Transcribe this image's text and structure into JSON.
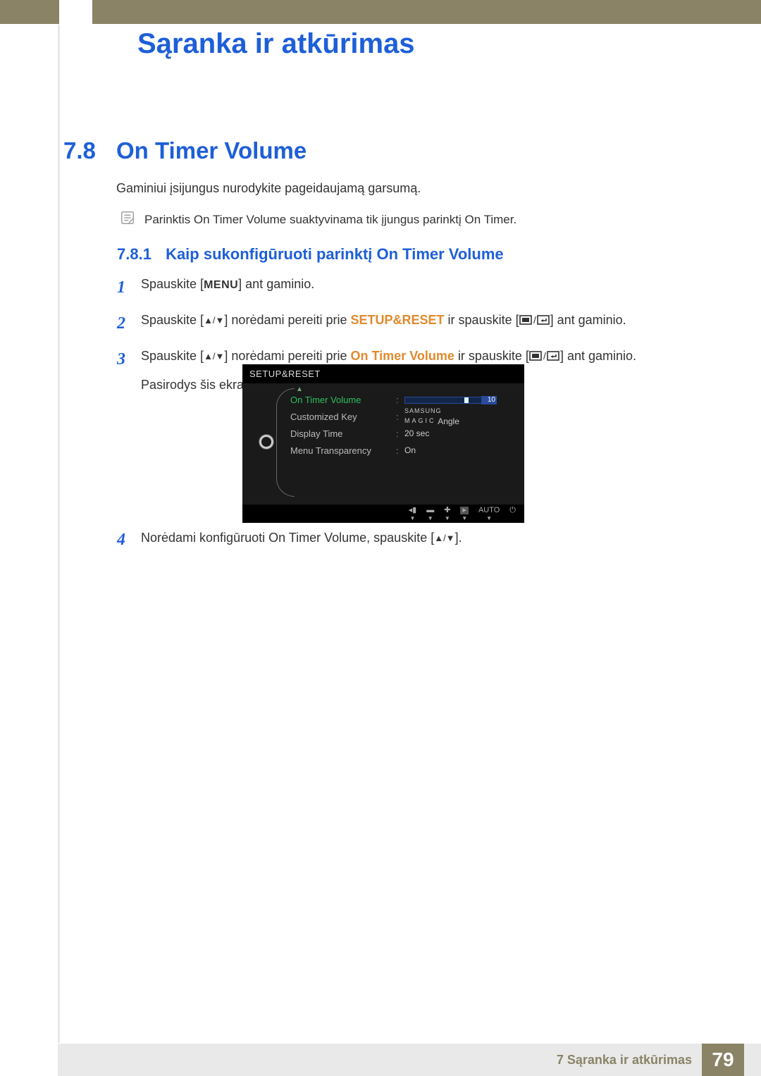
{
  "chapter_title": "Sąranka ir atkūrimas",
  "section": {
    "num": "7.8",
    "title": "On Timer Volume"
  },
  "intro": "Gaminiui įsijungus nurodykite pageidaujamą garsumą.",
  "note": {
    "pre": "Parinktis ",
    "kw1": "On Timer Volume",
    "mid": " suaktyvinama tik įjungus parinktį ",
    "kw2": "On Timer",
    "post": "."
  },
  "subsection": {
    "num": "7.8.1",
    "title": "Kaip sukonfigūruoti parinktį On Timer Volume"
  },
  "steps": {
    "s1": {
      "n": "1",
      "a": "Spauskite [",
      "menu": "MENU",
      "b": "] ant gaminio."
    },
    "s2": {
      "n": "2",
      "a": "Spauskite [",
      "b": "] norėdami pereiti prie ",
      "kw": "SETUP&RESET",
      "c": " ir spauskite [",
      "d": "] ant gaminio."
    },
    "s3": {
      "n": "3",
      "a": "Spauskite [",
      "b": "] norėdami pereiti prie ",
      "kw": "On Timer Volume",
      "c": " ir spauskite [",
      "d": "] ant gaminio.",
      "line2": "Pasirodys šis ekrano rodinys:"
    },
    "s4": {
      "n": "4",
      "a": "Norėdami konfigūruoti ",
      "kw": "On Timer Volume",
      "b": ", spauskite [",
      "c": "]."
    }
  },
  "arrows_glyph": "▲/▼",
  "osd": {
    "title": "SETUP&RESET",
    "rows": [
      {
        "label": "On Timer  Volume",
        "value_type": "slider",
        "value": "10"
      },
      {
        "label": "Customized Key",
        "value_type": "text",
        "value_pre": "SAMSUNG",
        "value": " Angle",
        "magic": "MAGIC"
      },
      {
        "label": "Display Time",
        "value_type": "text",
        "value": "20 sec"
      },
      {
        "label": "Menu Transparency",
        "value_type": "text",
        "value": "On"
      }
    ],
    "footer_auto": "AUTO"
  },
  "footer": {
    "text": "7 Sąranka ir atkūrimas",
    "page": "79"
  }
}
